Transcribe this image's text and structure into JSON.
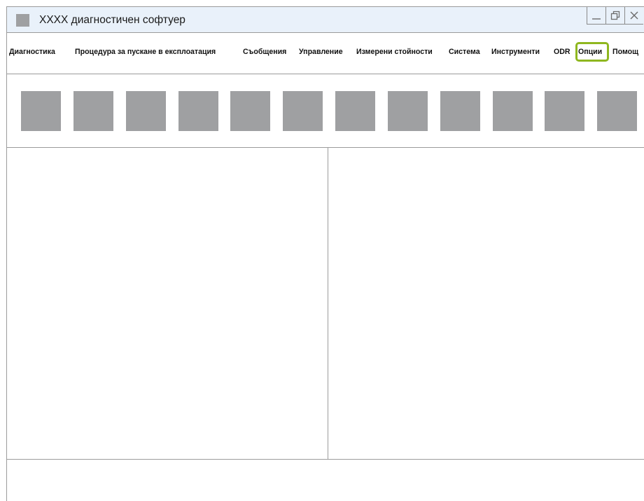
{
  "window": {
    "title": "XXXX диагностичен софтуер",
    "icon": "app-square-icon",
    "controls": [
      "minimize-icon",
      "restore-icon",
      "close-icon"
    ]
  },
  "menu": {
    "items": [
      {
        "label": "Диагностика"
      },
      {
        "label": "Процедура за пускане в експлоатация"
      },
      {
        "label": "Съобщения"
      },
      {
        "label": "Управление"
      },
      {
        "label": "Измерени стойности"
      },
      {
        "label": "Система"
      },
      {
        "label": "Инструменти"
      },
      {
        "label": "ODR"
      },
      {
        "label": "Опции",
        "highlighted": true
      },
      {
        "label": "Помощ"
      }
    ],
    "highlight_color": "#8fb71f"
  },
  "toolbar": {
    "button_count": 12,
    "button_color": "#9fa0a2"
  },
  "colors": {
    "titlebar_bg": "#e9f1fa",
    "border": "#9b9b9b"
  }
}
